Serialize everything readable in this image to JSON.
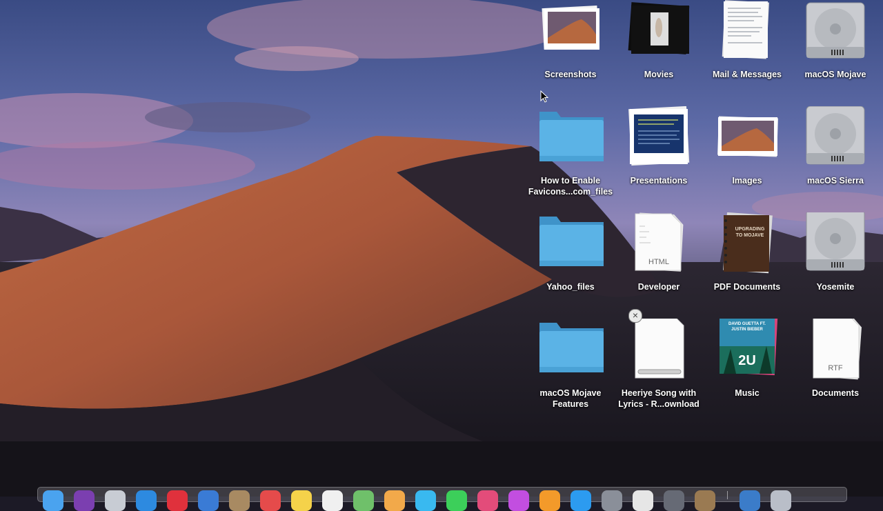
{
  "desktop": {
    "icons": [
      {
        "name": "Screenshots",
        "icon": "photo-stack-icon"
      },
      {
        "name": "Movies",
        "icon": "movie-stack-icon"
      },
      {
        "name": "Mail & Messages",
        "icon": "document-stack-icon"
      },
      {
        "name": "macOS Mojave",
        "icon": "hard-drive-icon"
      },
      {
        "name": "How to Enable\nFavicons...com_files",
        "icon": "folder-icon"
      },
      {
        "name": "Presentations",
        "icon": "presentation-stack-icon"
      },
      {
        "name": "Images",
        "icon": "photo-stack-icon"
      },
      {
        "name": "macOS Sierra",
        "icon": "hard-drive-icon"
      },
      {
        "name": "Yahoo_files",
        "icon": "folder-icon"
      },
      {
        "name": "Developer",
        "icon": "html-document-stack-icon",
        "badge": "HTML"
      },
      {
        "name": "PDF Documents",
        "icon": "pdf-stack-icon",
        "cover_text": "UPGRADING TO MOJAVE"
      },
      {
        "name": "Yosemite",
        "icon": "hard-drive-icon"
      },
      {
        "name": "macOS Mojave\nFeatures",
        "icon": "folder-icon"
      },
      {
        "name": "Heeriye Song with\nLyrics - R...ownload",
        "icon": "downloading-file-icon",
        "download_progress": 0.0
      },
      {
        "name": "Music",
        "icon": "album-art-stack-icon",
        "cover_text": "DAVID GUETTA FT. JUSTIN BIEBER",
        "cover_title": "2U"
      },
      {
        "name": "Documents",
        "icon": "rtf-document-stack-icon",
        "badge": "RTF"
      }
    ]
  },
  "dock": {
    "apps": [
      {
        "name": "finder-icon",
        "color": "#4aa3ef"
      },
      {
        "name": "siri-icon",
        "color": "#7b3fb0"
      },
      {
        "name": "launchpad-icon",
        "color": "#c8ccd4"
      },
      {
        "name": "safari-icon",
        "color": "#2d8ae0"
      },
      {
        "name": "music-icon",
        "color": "#e0313c"
      },
      {
        "name": "mail-icon",
        "color": "#3a7bd5"
      },
      {
        "name": "contacts-icon",
        "color": "#a88a62"
      },
      {
        "name": "calendar-icon",
        "color": "#e54b4b"
      },
      {
        "name": "notes-icon",
        "color": "#f5d24a"
      },
      {
        "name": "reminders-icon",
        "color": "#f0f0f0"
      },
      {
        "name": "maps-icon",
        "color": "#6fc06a"
      },
      {
        "name": "photos-icon",
        "color": "#f2a94a"
      },
      {
        "name": "messages-icon",
        "color": "#39b9f0"
      },
      {
        "name": "facetime-icon",
        "color": "#3ccf5a"
      },
      {
        "name": "itunes-icon",
        "color": "#e34c7a"
      },
      {
        "name": "podcasts-icon",
        "color": "#c24ee0"
      },
      {
        "name": "books-icon",
        "color": "#f39a2a"
      },
      {
        "name": "app-store-icon",
        "color": "#2c9bf0"
      },
      {
        "name": "system-preferences-icon",
        "color": "#8a8f99"
      },
      {
        "name": "textedit-icon",
        "color": "#e6e6e6"
      },
      {
        "name": "disk-utility-icon",
        "color": "#666a75"
      },
      {
        "name": "preview-icon",
        "color": "#9a7a52"
      },
      {
        "name": "downloads-stack-icon",
        "color": "#3b7cc9"
      },
      {
        "name": "trash-icon",
        "color": "#b9bec8"
      }
    ]
  },
  "colors": {
    "folder": "#5bb3e6",
    "sky_top": "#3d4e86",
    "dune": "#b5603a"
  }
}
